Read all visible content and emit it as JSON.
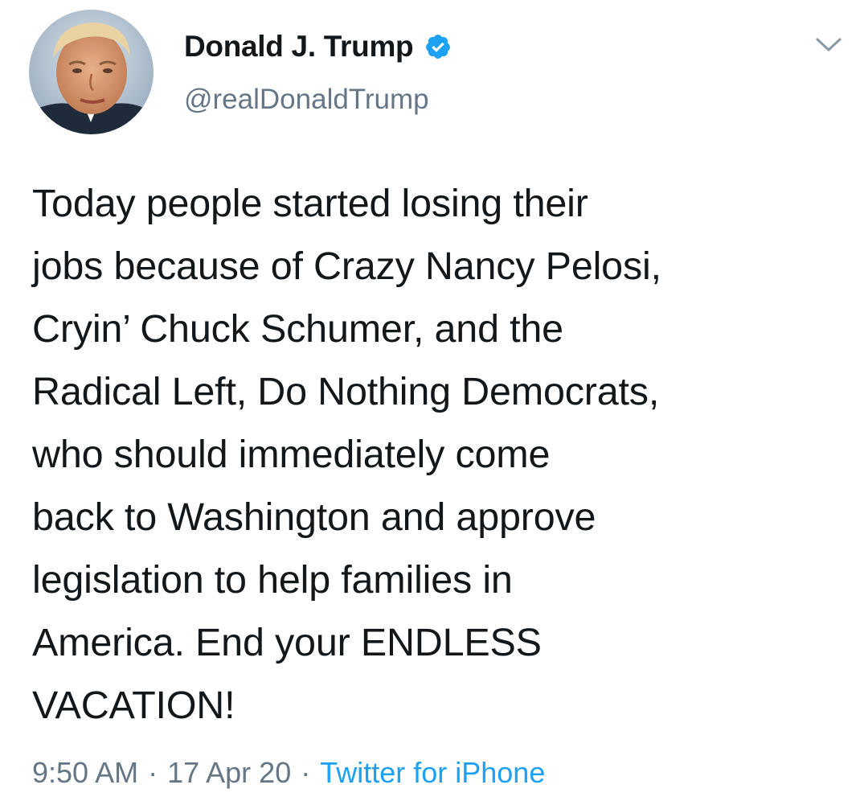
{
  "tweet": {
    "author": {
      "display_name": "Donald J. Trump",
      "handle": "@realDonaldTrump",
      "verified": true,
      "avatar_icon": "profile-photo-icon"
    },
    "text_lines": [
      "Today people started losing their",
      "jobs because of Crazy Nancy Pelosi,",
      "Cryin’ Chuck Schumer, and the",
      "Radical Left, Do Nothing Democrats,",
      "who should immediately come",
      "back to Washington and approve",
      "legislation to help families in",
      "America. End your ENDLESS",
      "VACATION!"
    ],
    "meta": {
      "time": "9:50 AM",
      "separator": "·",
      "date": "17 Apr 20",
      "source": "Twitter for iPhone"
    },
    "menu_icon": "chevron-down-icon"
  },
  "colors": {
    "text": "#14171a",
    "secondary": "#657786",
    "accent": "#1da1f2",
    "background": "#ffffff"
  }
}
